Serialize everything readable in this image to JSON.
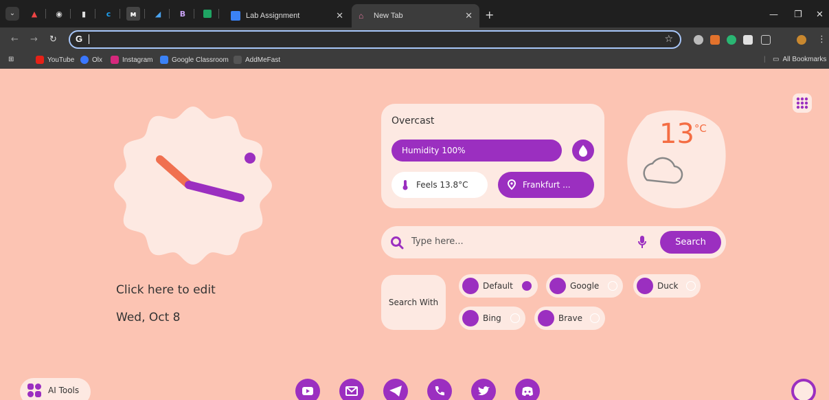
{
  "browser": {
    "tabs": [
      {
        "label": "Lab Assignment",
        "active": false
      },
      {
        "label": "New Tab",
        "active": true
      }
    ],
    "pinned_letters": {
      "c": "c",
      "m": "м",
      "b": "B"
    },
    "new_tab_symbol": "+",
    "close_symbol": "✕",
    "omnibox": {
      "value": "",
      "glyph": "G"
    },
    "bookmarks": [
      "YouTube",
      "Olx",
      "Instagram",
      "Google Classroom",
      "AddMeFast"
    ],
    "all_bookmarks": "All Bookmarks"
  },
  "clock": {
    "edit_label": "Click here to edit",
    "date": "Wed, Oct 8"
  },
  "weather": {
    "condition": "Overcast",
    "humidity": "Humidity 100%",
    "feels": "Feels 13.8°C",
    "location": "Frankfurt ...",
    "temp_value": "13",
    "temp_unit": "°C"
  },
  "search": {
    "placeholder": "Type here...",
    "button": "Search"
  },
  "search_with": {
    "label": "Search With",
    "engines": [
      {
        "name": "Default",
        "selected": true
      },
      {
        "name": "Google",
        "selected": false
      },
      {
        "name": "Duck",
        "selected": false
      },
      {
        "name": "Bing",
        "selected": false
      },
      {
        "name": "Brave",
        "selected": false
      }
    ]
  },
  "ai_tools": "AI Tools",
  "social_icons": [
    "youtube-icon",
    "mail-icon",
    "telegram-icon",
    "phone-icon",
    "twitter-icon",
    "discord-icon"
  ],
  "colors": {
    "background": "#fcc4b3",
    "accent": "#9b2fc0",
    "card": "#fde9e2",
    "temp": "#f46d43",
    "hour_hand": "#f07050"
  }
}
